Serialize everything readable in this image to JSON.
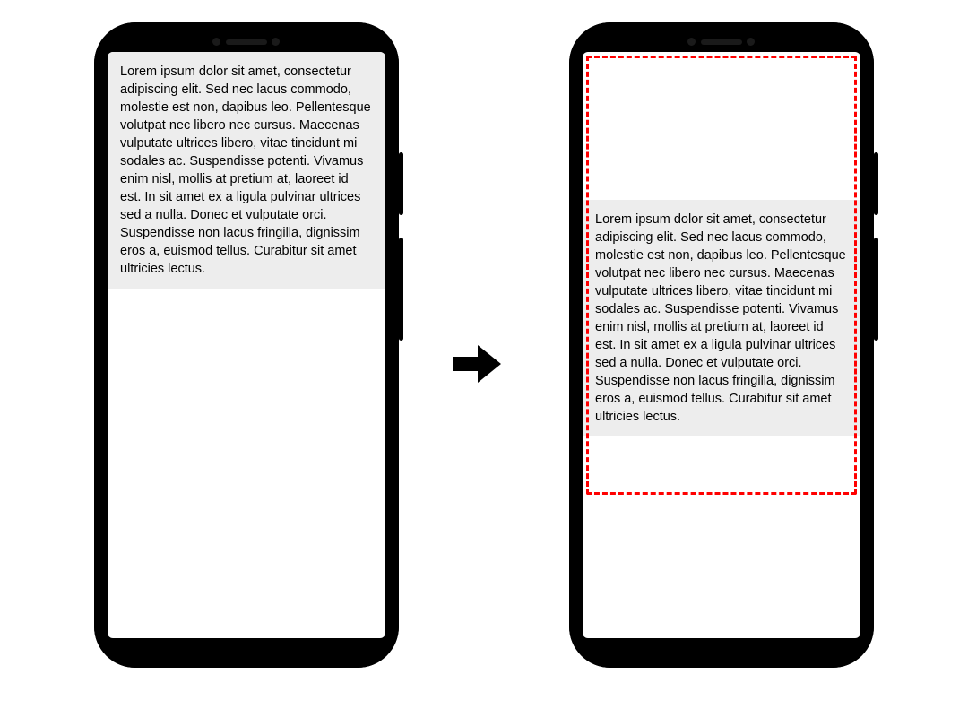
{
  "lorem_text": "Lorem ipsum dolor sit amet, consectetur adipiscing elit. Sed nec lacus commodo, molestie est non, dapibus leo. Pellentesque volutpat nec libero nec cursus. Maecenas vulputate ultrices libero, vitae tincidunt mi sodales ac. Suspendisse potenti. Vivamus enim nisl, mollis at pretium at, laoreet id est. In sit amet ex a ligula pulvinar ultrices sed a nulla. Donec et vulputate orci. Suspendisse non lacus fringilla, dignissim eros a, euismod tellus. Curabitur sit amet ultricies lectus.",
  "highlight_color": "#ff0000",
  "arrow_direction": "right",
  "left_state": "content at top, no constraint box",
  "right_state": "content pushed down, red dashed constraint box overlay"
}
